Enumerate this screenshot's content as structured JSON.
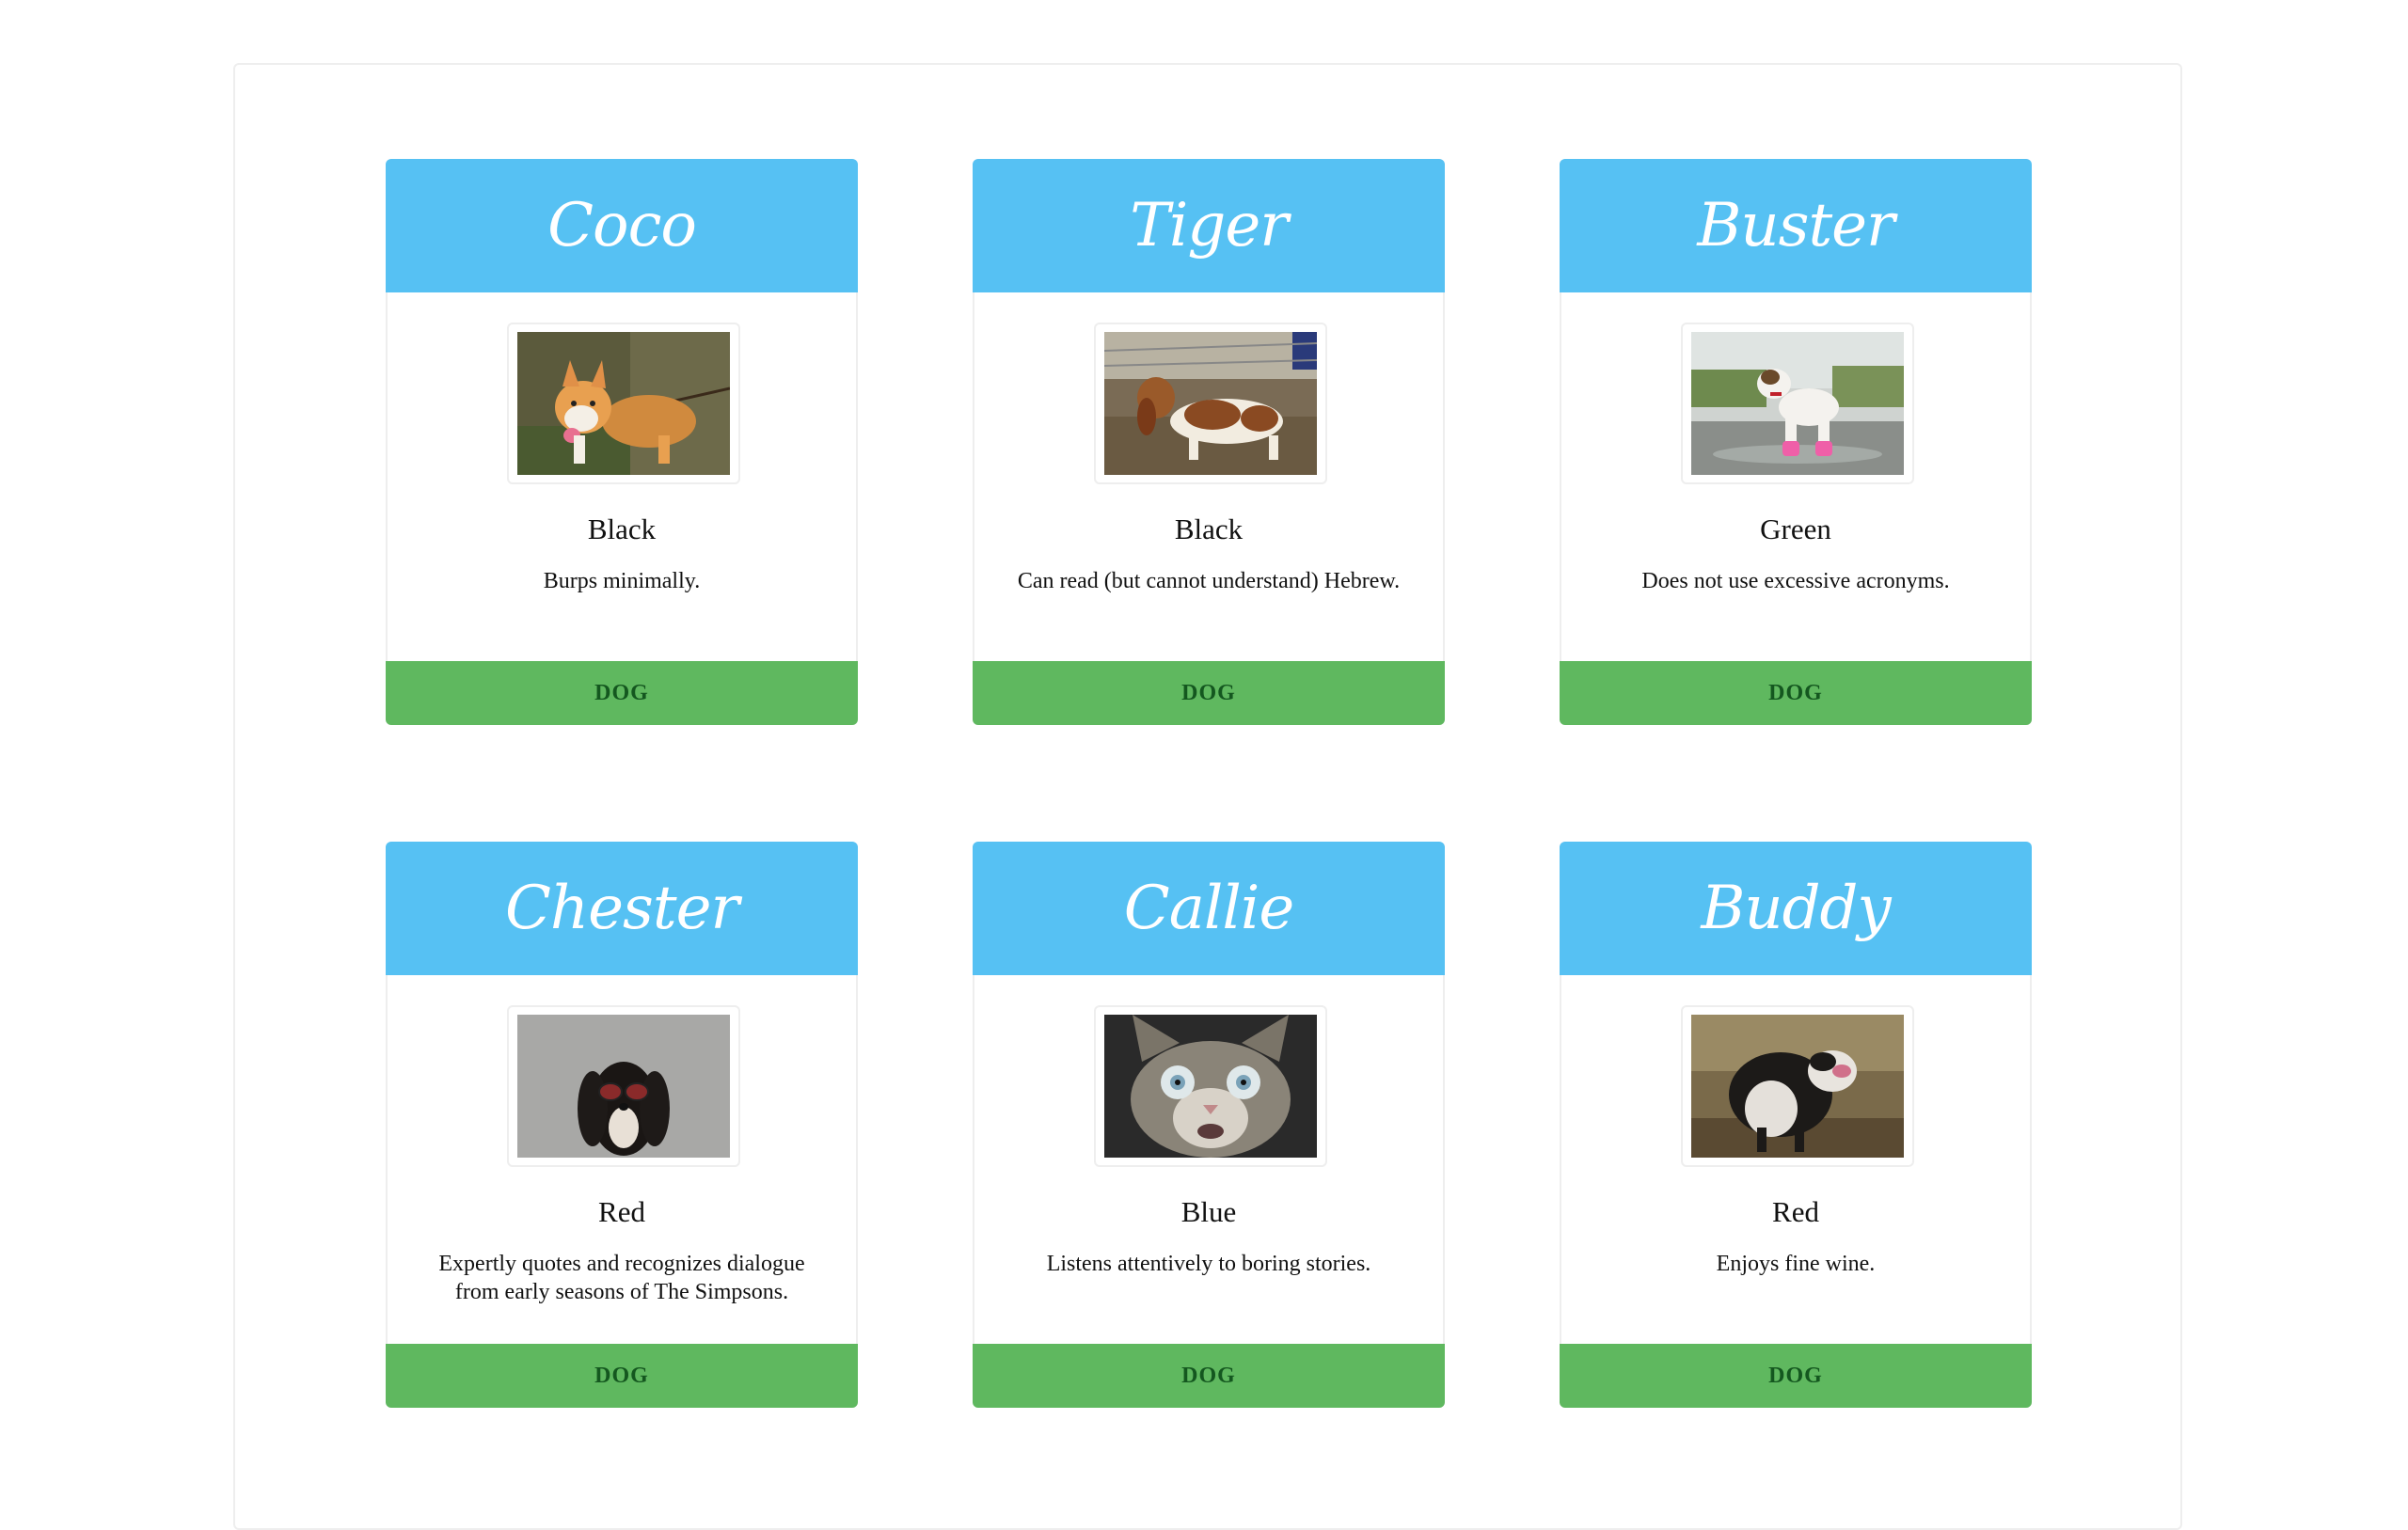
{
  "pets": [
    {
      "name": "Coco",
      "color": "Black",
      "description": "Burps minimally.",
      "type": "DOG",
      "photo": "corgi-on-leash"
    },
    {
      "name": "Tiger",
      "color": "Black",
      "description": "Can read (but cannot understand) Hebrew.",
      "type": "DOG",
      "photo": "basset-hound"
    },
    {
      "name": "Buster",
      "color": "Green",
      "description": "Does not use excessive acronyms.",
      "type": "DOG",
      "photo": "terrier-pink-boots"
    },
    {
      "name": "Chester",
      "color": "Red",
      "description": "Expertly quotes and recognizes dialogue from early seasons of The Simpsons.",
      "type": "DOG",
      "photo": "spaniel-sunglasses"
    },
    {
      "name": "Callie",
      "color": "Blue",
      "description": "Listens attentively to boring stories.",
      "type": "DOG",
      "photo": "startled-tabby-cat"
    },
    {
      "name": "Buddy",
      "color": "Red",
      "description": "Enjoys fine wine.",
      "type": "DOG",
      "photo": "wet-dog-shaking"
    }
  ],
  "colors": {
    "header": "#56c1f3",
    "footer": "#5fb85f",
    "footer_text": "#14571f",
    "border": "#eeeeee"
  }
}
